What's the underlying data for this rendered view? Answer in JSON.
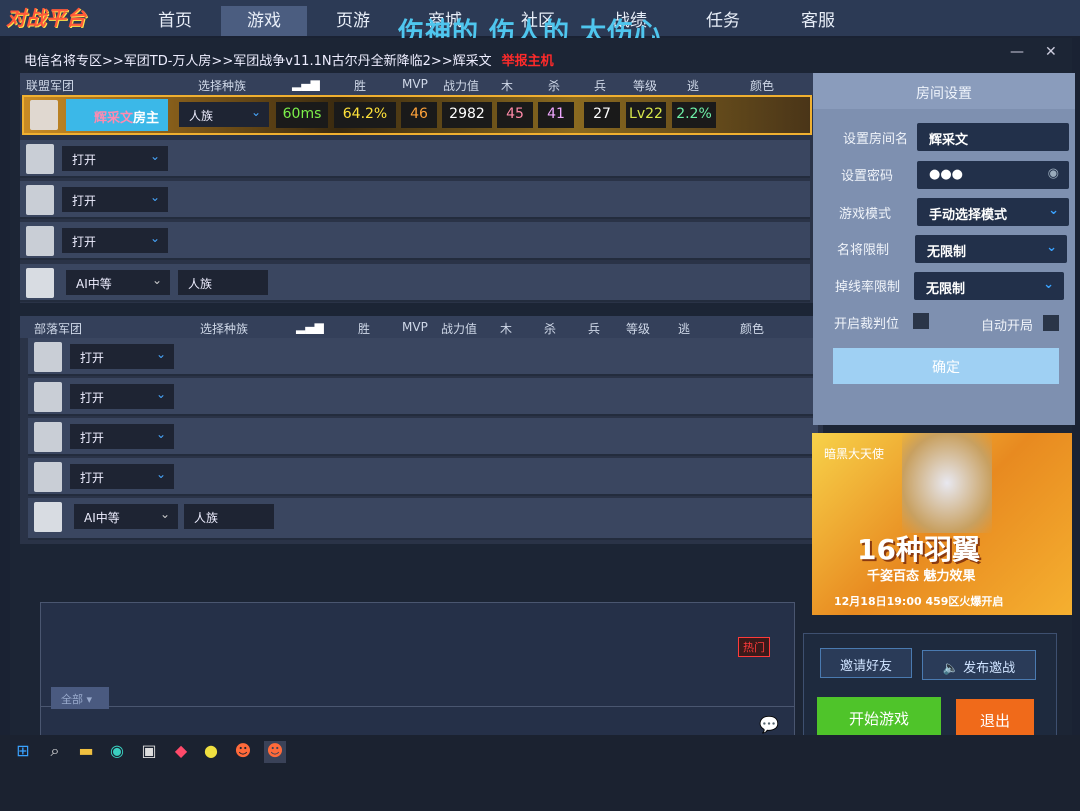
{
  "nav": {
    "logo": "对战平台",
    "items": [
      "首页",
      "游戏",
      "页游",
      "商城",
      "社区",
      "战绩",
      "任务",
      "客服"
    ],
    "active": 1,
    "overlay_text": "伤神的 伤人的 太伤心"
  },
  "breadcrumb": {
    "path": "电信名将专区>>军团TD-万人房>>军团战争v11.1N古尔丹全新降临2>>辉采文",
    "report": "举报主机"
  },
  "columns": {
    "race": "选择种族",
    "win": "胜",
    "mvp": "MVP",
    "power": "战力值",
    "wood": "木",
    "kill": "杀",
    "soldier": "兵",
    "level": "等级",
    "escape": "逃",
    "color": "颜色"
  },
  "alliance": {
    "title": "联盟军团",
    "host": {
      "name": "辉采文",
      "role": "房主",
      "race": "人族",
      "ping": "60ms",
      "win": "64.2%",
      "mvp": "46",
      "power": "2982",
      "wood": "45",
      "kill": "41",
      "soldier": "27",
      "level": "Lv22",
      "escape": "2.2%"
    },
    "slots": [
      {
        "state": "打开"
      },
      {
        "state": "打开"
      },
      {
        "state": "打开"
      }
    ],
    "ai": {
      "level": "AI中等",
      "race": "人族"
    }
  },
  "horde": {
    "title": "部落军团",
    "slots": [
      {
        "state": "打开"
      },
      {
        "state": "打开"
      },
      {
        "state": "打开"
      },
      {
        "state": "打开"
      }
    ],
    "ai": {
      "level": "AI中等",
      "race": "人族"
    }
  },
  "room": {
    "title": "房间设置",
    "name_label": "设置房间名",
    "name": "辉采文",
    "pwd_label": "设置密码",
    "pwd": "●●●",
    "mode_label": "游戏模式",
    "mode": "手动选择模式",
    "hero_label": "名将限制",
    "hero": "无限制",
    "drop_label": "掉线率限制",
    "drop": "无限制",
    "judge_label": "开启裁判位",
    "auto_label": "自动开局",
    "ok": "确定"
  },
  "ad": {
    "brand": "暗黑大天使",
    "title": "16种羽翼",
    "sub": "千姿百态 魅力效果",
    "date": "12月18日19:00 459区火爆开启"
  },
  "chat": {
    "hot": "热门",
    "filter": "全部"
  },
  "actions": {
    "invite": "邀请好友",
    "challenge": "发布邀战",
    "start": "开始游戏",
    "exit": "退出"
  },
  "colors": {
    "accent": "#3aa2ff",
    "start": "#4fc42a",
    "exit": "#f06a1a",
    "report": "#ff2a2a"
  }
}
